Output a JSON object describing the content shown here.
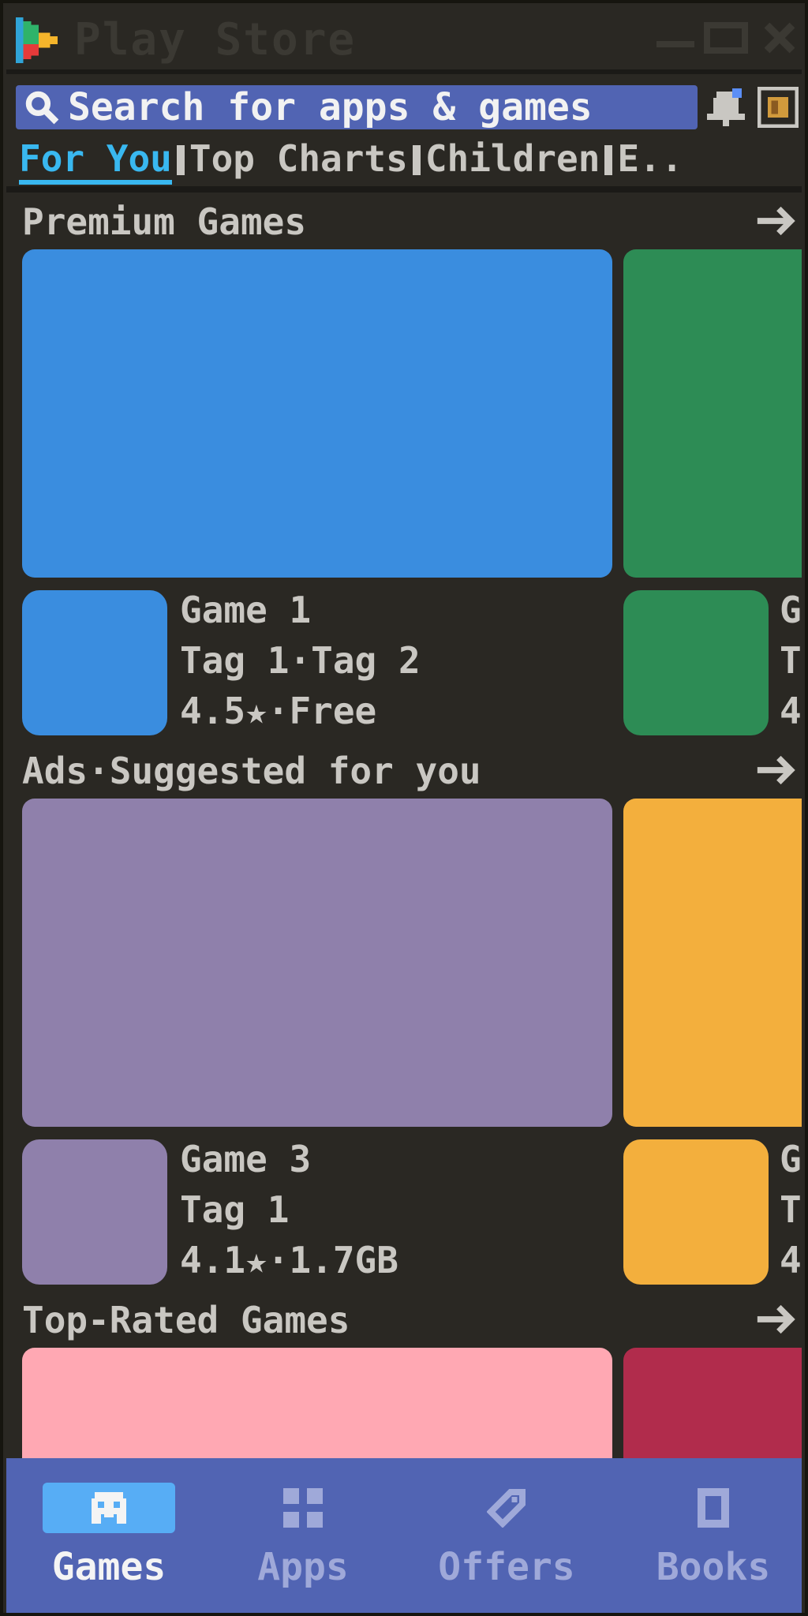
{
  "window": {
    "title": "Play Store",
    "controls": [
      "minimize",
      "maximize",
      "close"
    ]
  },
  "header": {
    "search_placeholder": "Search for apps & games",
    "icons": [
      "search-icon",
      "bell-icon",
      "avatar-icon"
    ]
  },
  "tabs": [
    {
      "label": "For You",
      "active": true
    },
    {
      "label": "Top Charts",
      "active": false
    },
    {
      "label": "Children",
      "active": false
    },
    {
      "label": "E..",
      "active": false
    }
  ],
  "sections": [
    {
      "title": "Premium Games",
      "banner_color": "#3a8ddf",
      "peek_color": "#2d8c55",
      "game": {
        "name": "Game 1",
        "tags": "Tag 1·Tag 2",
        "meta": "4.5★·Free"
      },
      "peek_initials": [
        "G",
        "T",
        "4"
      ]
    },
    {
      "title": "Ads·Suggested for you",
      "banner_color": "#8f80ab",
      "peek_color": "#f3af3d",
      "game": {
        "name": "Game 3",
        "tags": "Tag 1",
        "meta": "4.1★·1.7GB"
      },
      "peek_initials": [
        "G",
        "T",
        "4"
      ]
    },
    {
      "title": "Top-Rated Games",
      "banner_color": "#ffa8b3",
      "peek_color": "#b12c4c"
    }
  ],
  "bottom_nav": [
    {
      "label": "Games",
      "icon": "gamepad-icon",
      "active": true
    },
    {
      "label": "Apps",
      "icon": "apps-grid-icon",
      "active": false
    },
    {
      "label": "Offers",
      "icon": "tag-icon",
      "active": false
    },
    {
      "label": "Books",
      "icon": "book-icon",
      "active": false
    }
  ],
  "colors": {
    "accent_tab": "#39b8f0",
    "nav_bg": "#5164b3",
    "nav_active": "#57adf5",
    "bg": "#2a2823"
  }
}
